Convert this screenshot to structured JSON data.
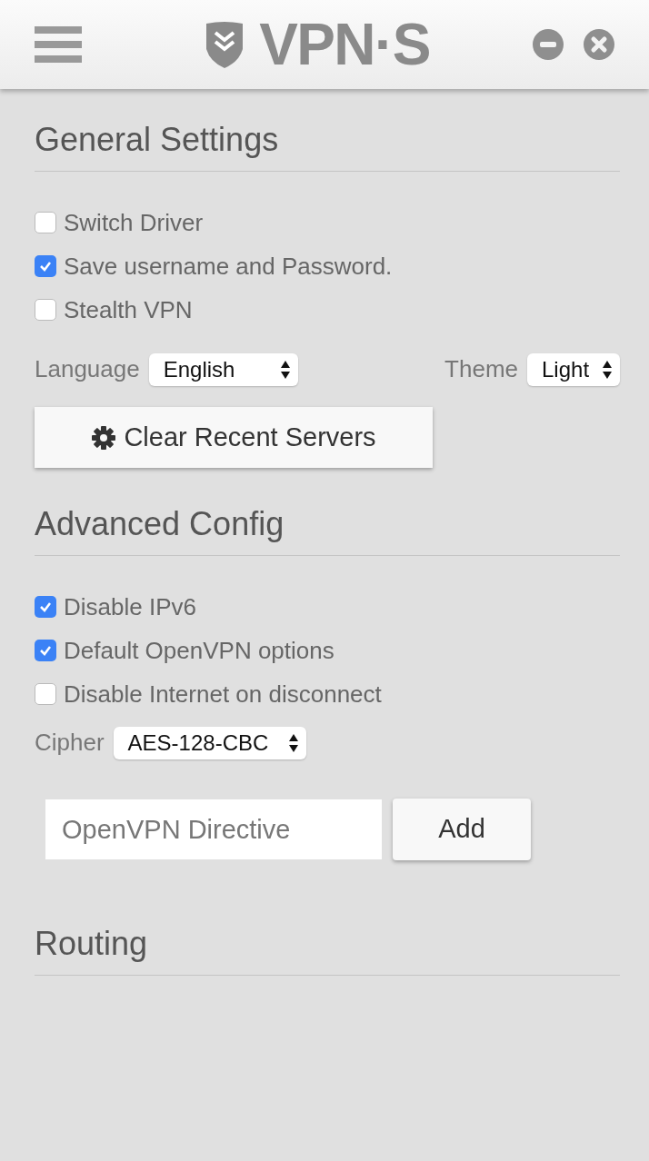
{
  "header": {
    "logo": "VPN·S"
  },
  "general": {
    "title": "General Settings",
    "options": [
      {
        "label": "Switch Driver",
        "checked": false
      },
      {
        "label": "Save username and Password.",
        "checked": true
      },
      {
        "label": "Stealth VPN",
        "checked": false
      }
    ],
    "language": {
      "label": "Language",
      "value": "English"
    },
    "theme": {
      "label": "Theme",
      "value": "Light"
    },
    "clear_button": "Clear Recent Servers"
  },
  "advanced": {
    "title": "Advanced Config",
    "options": [
      {
        "label": "Disable IPv6",
        "checked": true
      },
      {
        "label": "Default OpenVPN options",
        "checked": true
      },
      {
        "label": "Disable Internet on disconnect",
        "checked": false
      }
    ],
    "cipher": {
      "label": "Cipher",
      "value": "AES-128-CBC"
    },
    "directive": {
      "placeholder": "OpenVPN Directive"
    },
    "add_button": "Add"
  },
  "routing": {
    "title": "Routing"
  }
}
